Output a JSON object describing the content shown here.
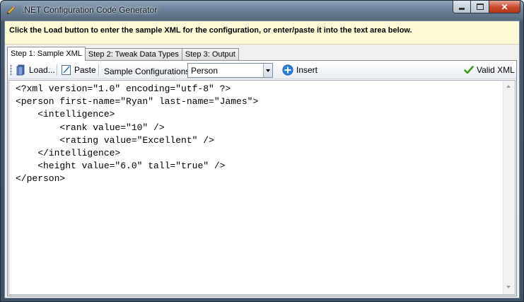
{
  "window": {
    "title": ".NET Configuration Code Generator",
    "controls": {
      "minimize": "minimize",
      "maximize": "maximize",
      "close": "✕"
    }
  },
  "banner": {
    "text": "Click the Load button to enter the sample XML for the configuration, or enter/paste it into the text area below."
  },
  "tabs": [
    {
      "label": "Step 1: Sample XML",
      "active": true
    },
    {
      "label": "Step 2: Tweak Data Types",
      "active": false
    },
    {
      "label": "Step 3: Output",
      "active": false
    }
  ],
  "toolbar": {
    "load_label": "Load...",
    "paste_label": "Paste",
    "sample_label": "Sample Configurations:",
    "sample_selected": "Person",
    "insert_label": "Insert",
    "valid_label": "Valid XML"
  },
  "editor": {
    "text": "<?xml version=\"1.0\" encoding=\"utf-8\" ?>\n<person first-name=\"Ryan\" last-name=\"James\">\n    <intelligence>\n        <rank value=\"10\" />\n        <rating value=\"Excellent\" />\n    </intelligence>\n    <height value=\"6.0\" tall=\"true\" />\n</person>"
  },
  "colors": {
    "banner_bg": "#fdfbd7",
    "valid_check": "#3c9a1e",
    "insert_icon": "#2e7fd6",
    "close_button": "#c7482d"
  },
  "icons": {
    "app": "pencil-icon",
    "load": "book-icon",
    "paste": "paste-icon",
    "insert": "plus-circle-icon",
    "valid": "checkmark-icon"
  }
}
